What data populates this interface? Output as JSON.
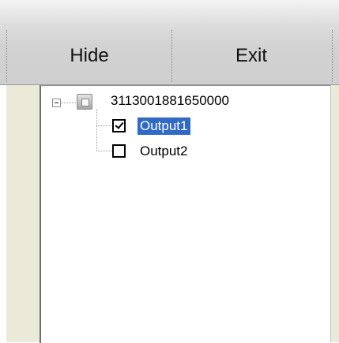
{
  "toolbar": {
    "hide_label": "Hide",
    "exit_label": "Exit"
  },
  "tree": {
    "root": {
      "label": "3113001881650000",
      "expanded": true,
      "icon": "device-icon"
    },
    "children": [
      {
        "label": "Output1",
        "checked": true,
        "selected": true
      },
      {
        "label": "Output2",
        "checked": false,
        "selected": false
      }
    ]
  },
  "colors": {
    "selection": "#316ac5",
    "toolbar": "#d6d6d6",
    "side_panel": "#ebe9d8"
  }
}
